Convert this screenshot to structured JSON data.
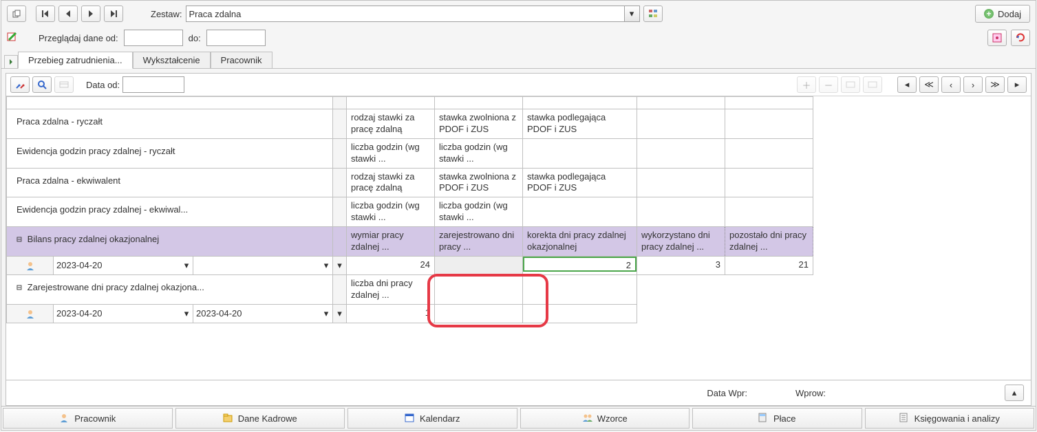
{
  "top": {
    "zestaw_label": "Zestaw:",
    "zestaw_value": "Praca zdalna",
    "dodaj_label": "Dodaj"
  },
  "row2": {
    "browse_label": "Przeglądaj dane od:",
    "do_label": "do:",
    "from_value": "",
    "to_value": ""
  },
  "tabs1": {
    "t0": "Przebieg zatrudnienia...",
    "t1": "Wykształcenie",
    "t2": "Pracownik"
  },
  "gridtoolbar": {
    "data_od_label": "Data od:",
    "data_od_value": ""
  },
  "rows": {
    "r1_label": "Praca zdalna - ryczałt",
    "r1_c1": "rodzaj stawki za pracę zdalną",
    "r1_c2": "stawka zwolniona z PDOF i ZUS",
    "r1_c3": "stawka podlegająca PDOF i ZUS",
    "r2_label": "Ewidencja godzin pracy zdalnej - ryczałt",
    "r2_c1": "liczba godzin (wg stawki ...",
    "r2_c2": "liczba godzin (wg stawki ...",
    "r3_label": "Praca zdalna - ekwiwalent",
    "r3_c1": "rodzaj stawki za pracę zdalną",
    "r3_c2": "stawka zwolniona z PDOF i ZUS",
    "r3_c3": "stawka podlegająca PDOF i ZUS",
    "r4_label": "Ewidencja godzin pracy zdalnej - ekwiwal...",
    "r4_c1": "liczba godzin (wg stawki ...",
    "r4_c2": "liczba godzin (wg stawki ...",
    "r5_label": "Bilans pracy zdalnej okazjonalnej",
    "r5_c1": "wymiar pracy zdalnej ...",
    "r5_c2": "zarejestrowano dni pracy ...",
    "r5_c3": "korekta dni pracy zdalnej okazjonalnej",
    "r5_c4": "wykorzystano dni pracy zdalnej ...",
    "r5_c5": "pozostało dni pracy zdalnej ...",
    "r5d_date": "2023-04-20",
    "r5d_v1": "24",
    "r5d_v2": "",
    "r5d_v3": "2",
    "r5d_v4": "3",
    "r5d_v5": "21",
    "r6_label": "Zarejestrowane dni pracy zdalnej okazjona...",
    "r6_c1": "liczba dni pracy zdalnej ...",
    "r6d_date1": "2023-04-20",
    "r6d_date2": "2023-04-20",
    "r6d_v1": "1"
  },
  "footer": {
    "datawpr": "Data Wpr:",
    "wprow": "Wprow:"
  },
  "bottomtabs": {
    "t0": "Pracownik",
    "t1": "Dane Kadrowe",
    "t2": "Kalendarz",
    "t3": "Wzorce",
    "t4": "Płace",
    "t5": "Księgowania i analizy"
  }
}
